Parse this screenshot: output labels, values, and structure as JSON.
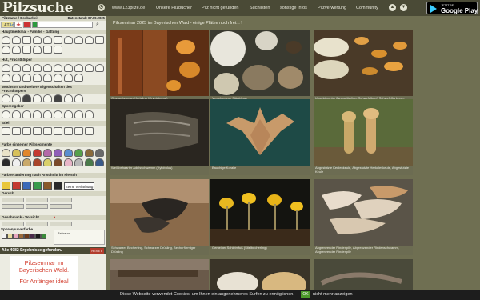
{
  "header": {
    "logo": "Pilzsuche",
    "nav": [
      "www.123pilze.de",
      "Unsere Pilzbücher",
      "Pilz nicht gefunden",
      "Suchlisten",
      "sonstige Infos",
      "Pilzverwertung",
      "Community"
    ],
    "gplay_small": "JETZT BEI",
    "gplay_big": "Google Play"
  },
  "sidebar": {
    "head_left": "Pilzname / Essbarkeit",
    "head_right": "Datenstand: 07.09.2025",
    "lang_label": "LAT",
    "lang_label2": "An",
    "sections": {
      "hauptmerkmal": "Hauptmerkmal - Familie - Gattung",
      "hut": "Hut, Fruchtkörper",
      "wuchsort": "Wuchsort und weitere Eigenschaften des Fruchtkörpers",
      "sporengeber": "Sporengeber",
      "stiel": "Stiel",
      "farbe": "Farbe einzelner Pilzsegmente",
      "verfaerbung": "Farbveränderung nach Anschnitt im Fleisch",
      "geruch": "Geruch",
      "geschmack": "Geschmack - Vorsicht",
      "sporenpulver": "Sporenpulverfarbe"
    },
    "keine_verfaerbung": "Keine Verfärbung",
    "zeitraum": "Zeitraum",
    "result_text": "Alle 4082 Ergebnisse gefunden.",
    "reset_label": "RESET",
    "promo_line1": "Pilzseminar im Bayerischen Wald.",
    "promo_line2": "Für Anfänger ideal"
  },
  "main": {
    "title": "Pilzseminar 2025 im Bayerischen Wald - einige Plätze noch frei... !",
    "cards": [
      {
        "caption": "Orangefarbener Kreisling (Cryptotrama)"
      },
      {
        "caption": "Verschiedene Stäublinge"
      },
      {
        "caption": "Ungekämmter Zwergritterling, Schwefelkopf, Schwefelfarbener, Gemeiner Knoppenhut"
      },
      {
        "caption": "Weißbehaarter Adelsschwamm (Xylobolus)"
      },
      {
        "caption": "Bauchige Koralle"
      },
      {
        "caption": "Abgestutzte Keulenkeule, Abgestutzte Herkuleskeule, Abgestutzte Keule"
      },
      {
        "caption": "Schwarzer Becherling, Schwarzer Drüsling, Becherförmiger Drüsling"
      },
      {
        "caption": "Gemeiner Schleimfuß (Stielbecherling)"
      },
      {
        "caption": "Abgrenzender Rindenpilz, Abgrenzender Rindenschwamm, Abgrenzender Rindenpilz"
      },
      {
        "caption": ""
      },
      {
        "caption": ""
      },
      {
        "caption": ""
      }
    ]
  },
  "cookie": {
    "text": "Diese Webseite verwendet Cookies, um Ihnen ein angenehmeres Surfen zu ermöglichen.",
    "ok": "OK",
    "nicht_mehr": "nicht mehr anzeigen"
  }
}
